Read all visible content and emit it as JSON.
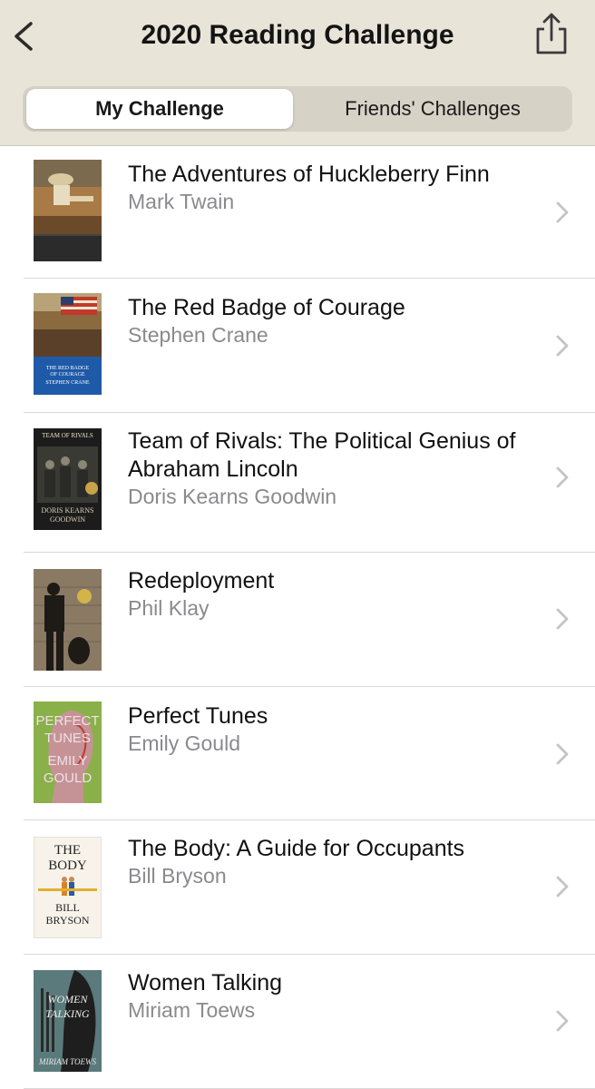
{
  "header": {
    "title": "2020 Reading Challenge",
    "back_icon": "chevron-left-icon",
    "share_icon": "share-icon"
  },
  "tabs": [
    {
      "label": "My Challenge",
      "selected": true
    },
    {
      "label": "Friends' Challenges",
      "selected": false
    }
  ],
  "books": [
    {
      "title": "The Adventures of Huckleberry Finn",
      "author": "Mark Twain"
    },
    {
      "title": "The Red Badge of Courage",
      "author": "Stephen Crane"
    },
    {
      "title": "Team of Rivals: The Political Genius of Abraham Lincoln",
      "author": "Doris Kearns Goodwin"
    },
    {
      "title": "Redeployment",
      "author": "Phil Klay"
    },
    {
      "title": "Perfect Tunes",
      "author": "Emily Gould"
    },
    {
      "title": "The Body: A Guide for Occupants",
      "author": "Bill Bryson"
    },
    {
      "title": "Women Talking",
      "author": "Miriam Toews"
    }
  ],
  "covers": {
    "redbadge_lines": [
      "THE RED BADGE",
      "OF COURAGE",
      "STEPHEN CRANE"
    ],
    "rivals_top": "TEAM OF RIVALS",
    "rivals_bottom": [
      "DORIS KEARNS",
      "GOODWIN"
    ],
    "tunes_lines": [
      "PERFECT",
      "TUNES",
      "EMILY",
      "GOULD"
    ],
    "body_top": [
      "THE",
      "BODY"
    ],
    "body_bottom": [
      "BILL",
      "BRYSON"
    ],
    "women_lines": [
      "WOMEN",
      "TALKING"
    ],
    "women_author": "MIRIAM TOEWS"
  },
  "colors": {
    "header_bg": "#e8e4d8",
    "accent": "#1a1a1a",
    "secondary_text": "#8a8a8e"
  }
}
